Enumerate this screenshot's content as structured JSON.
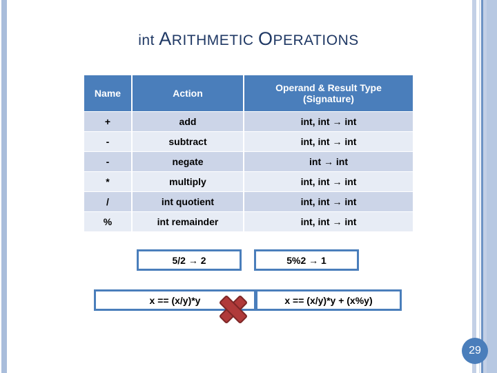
{
  "slide": {
    "title_pre": "int",
    "title_word1_cap": "A",
    "title_word1_rest": "RITHMETIC",
    "title_word2_cap": "O",
    "title_word2_rest": "PERATIONS",
    "title_full": "int Arithmetic Operations",
    "page_number": "29",
    "accent_blue": "#4a7ebb",
    "title_color": "#1f3864",
    "row_odd_color": "#ccd5e8",
    "row_even_color": "#e7ecf5",
    "xmark_color": "#b03a3a"
  },
  "table": {
    "headers": [
      "Name",
      "Action",
      "Operand & Result Type (Signature)"
    ],
    "header_sig_line1": "Operand & Result Type",
    "header_sig_line2": "(Signature)",
    "rows": [
      {
        "name": "+",
        "action": "add",
        "signature": "int, int → int"
      },
      {
        "name": "-",
        "action": "subtract",
        "signature": "int, int → int"
      },
      {
        "name": "-",
        "action": "negate",
        "signature": "int → int"
      },
      {
        "name": "*",
        "action": "multiply",
        "signature": "int, int → int"
      },
      {
        "name": "/",
        "action": "int quotient",
        "signature": "int, int → int"
      },
      {
        "name": "%",
        "action": "int remainder",
        "signature": "int, int → int"
      }
    ]
  },
  "callouts": {
    "example_division": "5/2 → 2",
    "example_modulus": "5%2 → 1",
    "identity_wrong": "x == (x/y)*y",
    "identity_right": "x == (x/y)*y + (x%y)"
  },
  "icons": {
    "xmark": "red-x-icon"
  }
}
